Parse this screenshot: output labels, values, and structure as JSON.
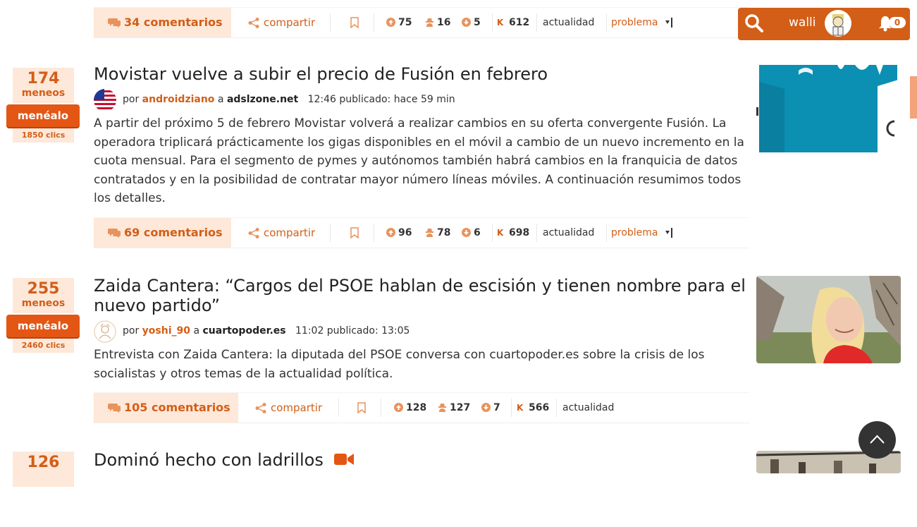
{
  "header": {
    "username": "walli",
    "notifications": "0"
  },
  "story0": {
    "comments": "34 comentarios",
    "share": "compartir",
    "up": "75",
    "anon": "16",
    "down": "5",
    "karma_label": "K",
    "karma": "612",
    "category": "actualidad",
    "problem": "problema"
  },
  "story1": {
    "votes": "174",
    "votes_label": "meneos",
    "menealo": "menéalo",
    "clicks": "1850 clics",
    "title": "Movistar vuelve a subir el precio de Fusión en febrero",
    "by": "por",
    "user": "androidziano",
    "to": "a",
    "site": "adslzone.net",
    "time": "12:46 publicado: hace 59 min",
    "description": "A partir del próximo 5 de febrero Movistar volverá a realizar cambios en su oferta convergente Fusión. La operadora triplicará prácticamente los gigas disponibles en el móvil a cambio de un nuevo incremento en la cuota mensual. Para el segmento de pymes y autónomos también habrá cambios en la franquicia de datos contratados y en la posibilidad de contratar mayor número líneas móviles. A continuación resumimos todos los detalles.",
    "comments": "69 comentarios",
    "share": "compartir",
    "up": "96",
    "anon": "78",
    "down": "6",
    "karma_label": "K",
    "karma": "698",
    "category": "actualidad",
    "problem": "problema"
  },
  "story2": {
    "votes": "255",
    "votes_label": "meneos",
    "menealo": "menéalo",
    "clicks": "2460 clics",
    "title": "Zaida Cantera: “Cargos del PSOE hablan de escisión y tienen nombre para el nuevo partido”",
    "by": "por",
    "user": "yoshi_90",
    "to": "a",
    "site": "cuartopoder.es",
    "time": "11:02 publicado: 13:05",
    "description": "Entrevista con Zaida Cantera: la diputada del PSOE conversa con cuartopoder.es sobre la crisis de los socialistas y otros temas de la actualidad política.",
    "comments": "105 comentarios",
    "share": "compartir",
    "up": "128",
    "anon": "127",
    "down": "7",
    "karma_label": "K",
    "karma": "566",
    "category": "actualidad"
  },
  "story3": {
    "votes": "126",
    "title": "Dominó hecho con ladrillos"
  },
  "colors": {
    "accent": "#d35e17",
    "button": "#e35614",
    "soft": "#fde8d9"
  }
}
